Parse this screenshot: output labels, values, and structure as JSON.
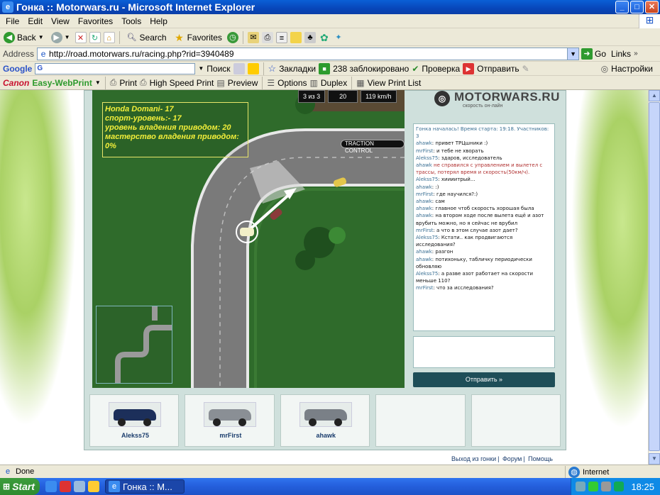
{
  "window": {
    "title": "Гонка :: Motorwars.ru - Microsoft Internet Explorer",
    "menu": [
      "File",
      "Edit",
      "View",
      "Favorites",
      "Tools",
      "Help"
    ]
  },
  "toolbar": {
    "back": "Back",
    "search": "Search",
    "favorites": "Favorites"
  },
  "address": {
    "label": "Address",
    "url": "http://road.motorwars.ru/racing.php?rid=3940489",
    "go": "Go",
    "links": "Links"
  },
  "google_bar": {
    "logo": "Google",
    "search_button": "Поиск",
    "bookmarks": "Закладки",
    "blocked": "238 заблокировано",
    "check": "Проверка",
    "send": "Отправить",
    "settings": "Настройки"
  },
  "canon_bar": {
    "brand": "Canon",
    "product": "Easy-WebPrint",
    "print": "Print",
    "high_speed_print": "High Speed Print",
    "preview": "Preview",
    "options": "Options",
    "duplex": "Duplex",
    "view_print_list": "View Print List"
  },
  "game": {
    "hud": {
      "lap": "3 из 3",
      "position": "20",
      "speed": "119 km/h"
    },
    "car_info": [
      "Honda Domani- 17",
      "спорт-уровень:- 17",
      "уровень владения приводом: 20",
      "мастерство владения приводом: 0%"
    ],
    "traction_control": "TRACTION CONTROL"
  },
  "site": {
    "logo_text": "MOTORWARS.RU",
    "tagline": "скорость он-лайн",
    "send_button": "Отправить »"
  },
  "chat": [
    {
      "type": "sys",
      "text": "Гонка началась! Время старта: 19:18. Участников: 3"
    },
    {
      "nick": "ahawk",
      "text": "привет ТРЦшники :)"
    },
    {
      "nick": "mrFirst",
      "text": "и тебе не хворать"
    },
    {
      "nick": "Alekss75",
      "text": "здаров, исследователь"
    },
    {
      "nick": "ahawk",
      "warn": true,
      "text": "не справился с управлением и вылетел с трассы, потерял время и скорость(50км/ч)."
    },
    {
      "nick": "Alekss75",
      "text": "хиииитрый..."
    },
    {
      "nick": "ahawk",
      "text": ":)"
    },
    {
      "nick": "mrFirst",
      "text": "где научился?:)"
    },
    {
      "nick": "ahawk",
      "text": "сам"
    },
    {
      "nick": "ahawk",
      "text": "главное чтоб скорость хорошая была"
    },
    {
      "nick": "ahawk",
      "text": "на втором ходе после вылета ещё и азот врубить можно, но я сейчас не врубил"
    },
    {
      "nick": "mrFirst",
      "text": "а что в этом случае азот дает?"
    },
    {
      "nick": "Alekss75",
      "text": "Кстати.. как продвигаются исследования?"
    },
    {
      "nick": "ahawk",
      "text": "разгон"
    },
    {
      "nick": "ahawk",
      "text": "потихоньку, табличку периодически обновляю"
    },
    {
      "nick": "Alekss75",
      "text": "а разве азот работает на скорости меньше 110?"
    },
    {
      "nick": "mrFirst",
      "text": "что за исследования?"
    }
  ],
  "players": [
    {
      "name": "Alekss75",
      "color": "#1c2f5a"
    },
    {
      "name": "mrFirst",
      "color": "#8a8f95"
    },
    {
      "name": "ahawk",
      "color": "#7a8087"
    },
    {
      "name": "",
      "color": ""
    },
    {
      "name": "",
      "color": ""
    }
  ],
  "footer": {
    "exit": "Выход из гонки",
    "forum": "Форум",
    "help": "Помощь"
  },
  "status": {
    "text": "Done",
    "zone": "Internet"
  },
  "taskbar": {
    "start": "Start",
    "task": "Гонка :: М...",
    "clock": "18:25"
  }
}
